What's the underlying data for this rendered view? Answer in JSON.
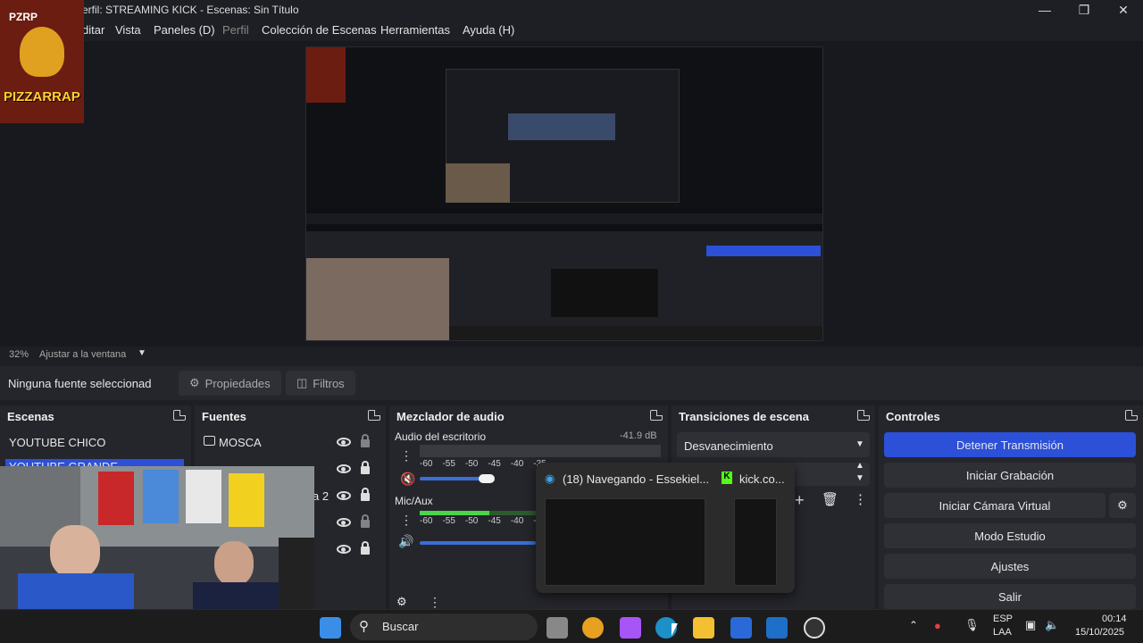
{
  "window": {
    "title": "erfil: STREAMING KICK - Escenas: Sin Título"
  },
  "menu": [
    "ditar",
    "Vista",
    "Paneles (D)",
    "Perfil",
    "Colección de Escenas",
    "Herramientas",
    "Ayuda (H)"
  ],
  "logo": {
    "top_text": "PZRP",
    "bottom_text": "PIZZARRAP"
  },
  "zoom": {
    "percent": "32%",
    "fit": "Ajustar a la ventana"
  },
  "source_toolbar": {
    "no_source": "Ninguna fuente seleccionad",
    "properties": "Propiedades",
    "filters": "Filtros"
  },
  "scenes": {
    "title": "Escenas",
    "items": [
      "YOUTUBE CHICO",
      "YOUTUBE GRANDE"
    ]
  },
  "sources": {
    "title": "Fuentes",
    "items": [
      "MOSCA",
      "",
      "a 2",
      "",
      ""
    ]
  },
  "mixer": {
    "title": "Mezclador de audio",
    "channels": [
      {
        "name": "Audio del escritorio",
        "db": "-41.9 dB",
        "level": 0.0
      },
      {
        "name": "Mic/Aux",
        "db": "",
        "level": 0.6
      }
    ],
    "ticks": [
      "-60",
      "-55",
      "-50",
      "-45",
      "-40",
      "-35"
    ]
  },
  "transitions": {
    "title": "Transiciones de escena",
    "selected": "Desvanecimiento"
  },
  "controls": {
    "title": "Controles",
    "buttons": [
      "Detener Transmisión",
      "Iniciar Grabación",
      "Iniciar Cámara Virtual",
      "Modo Estudio",
      "Ajustes",
      "Salir"
    ]
  },
  "popup": {
    "tab1": "(18) Navegando - Essekiel...",
    "tab2": "kick.co..."
  },
  "taskbar": {
    "search": "Buscar",
    "lang1": "ESP",
    "lang2": "LAA",
    "time": "00:14",
    "date": "15/10/2025"
  },
  "colors": {
    "accent": "#2c50d8",
    "bg": "#1e1f24",
    "dock": "#25262c"
  }
}
